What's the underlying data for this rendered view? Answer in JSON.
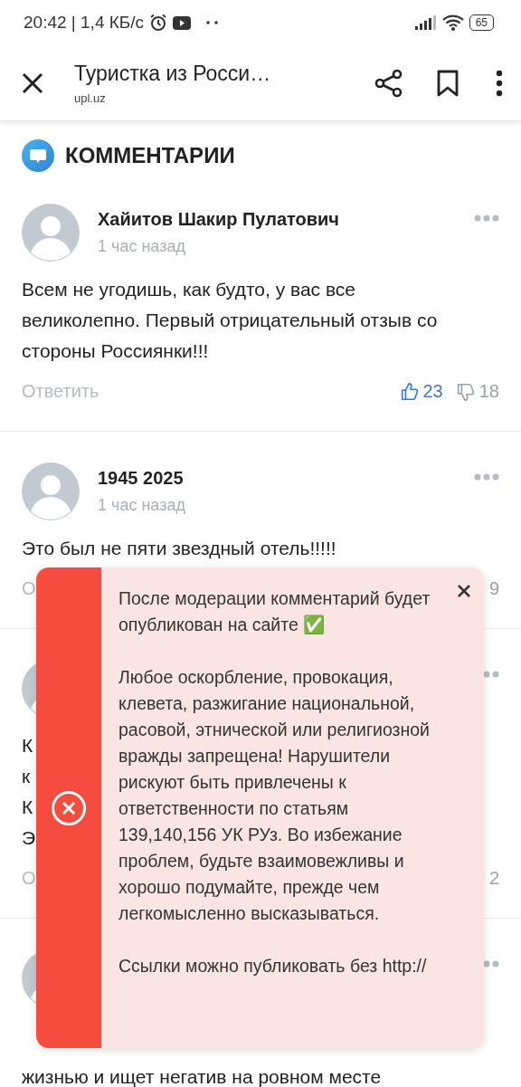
{
  "status_bar": {
    "time": "20:42 | 1,4 КБ/с",
    "battery": "65"
  },
  "app_bar": {
    "title": "Туристка из Росси…",
    "domain": "upl.uz"
  },
  "section": {
    "title": "КОММЕНТАРИИ"
  },
  "comments": [
    {
      "author": "Хайитов Шакир Пулатович",
      "time": "1 час назад",
      "text": "Всем не угодишь, как будто, у вас все великолепно. Первый отрицательный отзыв со стороны Россиянки!!!",
      "reply": "Ответить",
      "likes": "23",
      "dislikes": "18"
    },
    {
      "author": "1945 2025",
      "time": "1 час назад",
      "text": "Это был не пяти звездный отель!!!!!",
      "reply": "О",
      "dislikes": "9"
    },
    {
      "lines": [
        "К",
        "к",
        "К",
        "Э"
      ],
      "reply": "О",
      "dislikes": "2"
    },
    {
      "lines": [
        "жизнью и ищет негатив на ровном месте"
      ]
    }
  ],
  "toast": {
    "paragraphs": [
      "После модерации комментарий будет опубликован на сайте ✅",
      "Любое оскорбление, провокация, клевета, разжигание национальной, расовой, этнической или религиозной вражды запрещена! Нарушители рискуют быть привлечены к ответственности по статьям 139,140,156 УК РУз. Во избежание проблем, будьте взаимовежливы и хорошо подумайте, прежде чем легкомысленно высказываться.",
      "Ссылки можно публиковать без http://"
    ]
  }
}
